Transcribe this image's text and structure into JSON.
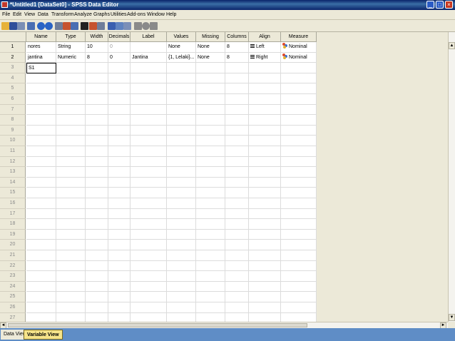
{
  "window": {
    "title": "*Untitled1 [DataSet0] - SPSS Data Editor"
  },
  "menu": [
    "File",
    "Edit",
    "View",
    "Data",
    "Transform",
    "Analyze",
    "Graphs",
    "Utilities",
    "Add-ons",
    "Window",
    "Help"
  ],
  "toolbar_icons": [
    "open-icon",
    "save-icon",
    "print-icon",
    "recall-dialog-icon",
    "undo-icon",
    "redo-icon",
    "goto-case-icon",
    "variables-icon",
    "find-icon",
    "insert-cases-icon",
    "insert-variable-icon",
    "split-file-icon",
    "weight-cases-icon",
    "select-cases-icon",
    "value-labels-icon",
    "use-sets-icon",
    "show-all-icon",
    "spell-check-icon"
  ],
  "columns": [
    "Name",
    "Type",
    "Width",
    "Decimals",
    "Label",
    "Values",
    "Missing",
    "Columns",
    "Align",
    "Measure"
  ],
  "rows": [
    {
      "num": "1",
      "name": "nores",
      "type": "String",
      "width": "10",
      "decimals": "0",
      "label": "",
      "values": "None",
      "missing": "None",
      "columns": "8",
      "align": "Left",
      "measure": "Nominal"
    },
    {
      "num": "2",
      "name": "jantina",
      "type": "Numeric",
      "width": "8",
      "decimals": "0",
      "label": "Jantina",
      "values": "{1, Lelaki}...",
      "missing": "None",
      "columns": "8",
      "align": "Right",
      "measure": "Nominal"
    },
    {
      "num": "3",
      "name": "S1"
    }
  ],
  "empty_row_numbers": [
    "4",
    "5",
    "6",
    "7",
    "8",
    "9",
    "10",
    "11",
    "12",
    "13",
    "14",
    "15",
    "16",
    "17",
    "18",
    "19",
    "20",
    "21",
    "22",
    "23",
    "24",
    "25",
    "26",
    "27"
  ],
  "tabs": {
    "data_view": "Data View",
    "variable_view": "Variable View"
  }
}
